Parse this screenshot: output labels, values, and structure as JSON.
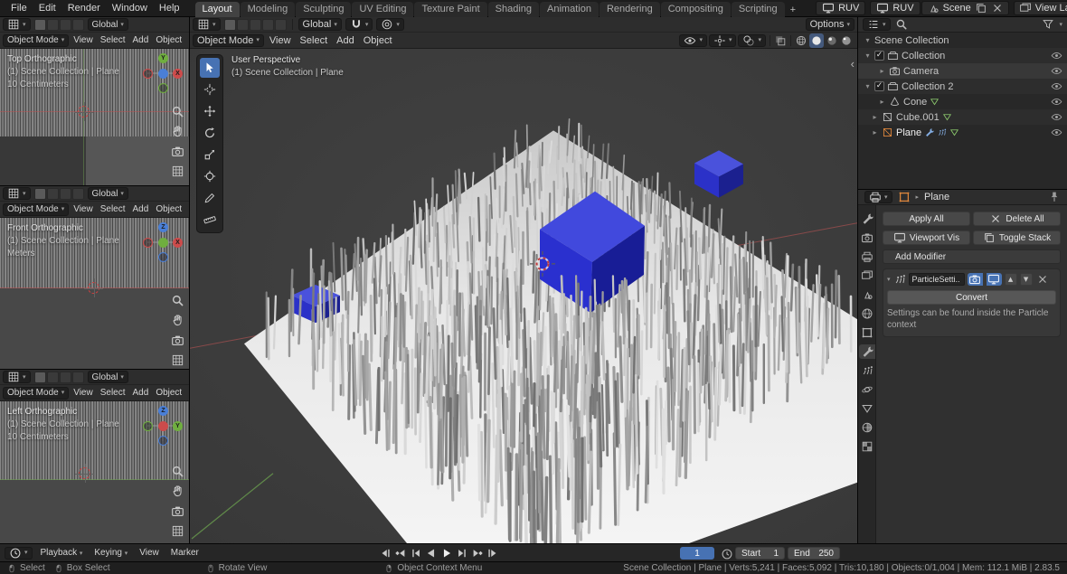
{
  "colors": {
    "accent": "#4772b3",
    "selection_orange": "#e0883d",
    "cube_blue": "#2a30cf",
    "header_bg": "#2d2d2d",
    "viewport_bg": "#3d3d3d",
    "plane_white": "#ededed"
  },
  "icons": [
    "blender-logo",
    "search",
    "filter",
    "eye",
    "zoom",
    "pan",
    "camera-view",
    "grid",
    "magnet",
    "proportional-editing",
    "wrench",
    "particles",
    "pin",
    "clock",
    "mouse-left",
    "mouse-middle",
    "mouse-right",
    "play",
    "skip",
    "keyframe-jump",
    "x-ray",
    "shading-spheres"
  ],
  "topbar": {
    "menus": [
      "File",
      "Edit",
      "Render",
      "Window",
      "Help"
    ],
    "tabs": [
      "Layout",
      "Modeling",
      "Sculpting",
      "UV Editing",
      "Texture Paint",
      "Shading",
      "Animation",
      "Rendering",
      "Compositing",
      "Scripting"
    ],
    "active_tab": "Layout",
    "add_tab": "+",
    "ruv_button_1": "RUV",
    "ruv_button_2": "RUV",
    "scene_name": "Scene",
    "view_layer_name": "View Layer"
  },
  "viewport_shared": {
    "mode": "Object Mode",
    "menus": [
      "View",
      "Select",
      "Add",
      "Object"
    ],
    "orientation": "Global",
    "context": "(1) Scene Collection | Plane"
  },
  "viewport_top": {
    "title": "Top Orthographic",
    "unit": "10 Centimeters"
  },
  "viewport_front": {
    "title": "Front Orthographic",
    "unit": "Meters"
  },
  "viewport_left": {
    "title": "Left Orthographic",
    "unit": "10 Centimeters"
  },
  "viewport_main": {
    "title": "User Perspective",
    "options": "Options",
    "sidebar_toggle": "‹"
  },
  "toolbar_tools": [
    "box-select",
    "cursor",
    "move",
    "rotate",
    "scale",
    "transform",
    "annotate",
    "measure"
  ],
  "outliner": {
    "rows": [
      {
        "name": "Scene Collection"
      },
      {
        "name": "Collection"
      },
      {
        "name": "Camera"
      },
      {
        "name": "Collection 2"
      },
      {
        "name": "Cone"
      },
      {
        "name": "Cube.001"
      },
      {
        "name": "Plane"
      }
    ]
  },
  "properties": {
    "tabs": [
      "tool",
      "render",
      "output",
      "view-layer",
      "scene",
      "world",
      "object",
      "modifiers",
      "particles",
      "physics",
      "object-data",
      "material",
      "texture"
    ],
    "active_tab": "modifiers",
    "breadcrumb": "Plane",
    "apply_all": "Apply All",
    "delete_all": "Delete All",
    "viewport_vis": "Viewport Vis",
    "toggle_stack": "Toggle Stack",
    "add_modifier": "Add Modifier",
    "modifier_name": "ParticleSetti..",
    "convert": "Convert",
    "note": "Settings can be found inside the Particle context"
  },
  "timeline": {
    "menus": [
      "Playback",
      "Keying",
      "View",
      "Marker"
    ],
    "current_frame": "1",
    "start_label": "Start",
    "start_value": "1",
    "end_label": "End",
    "end_value": "250"
  },
  "statusbar": {
    "hints": [
      "Select",
      "Box Select",
      "Rotate View",
      "Object Context Menu"
    ],
    "stats": "Scene Collection | Plane | Verts:5,241 | Faces:5,092 | Tris:10,180 | Objects:0/1,004 | Mem: 112.1 MiB | 2.83.5"
  }
}
